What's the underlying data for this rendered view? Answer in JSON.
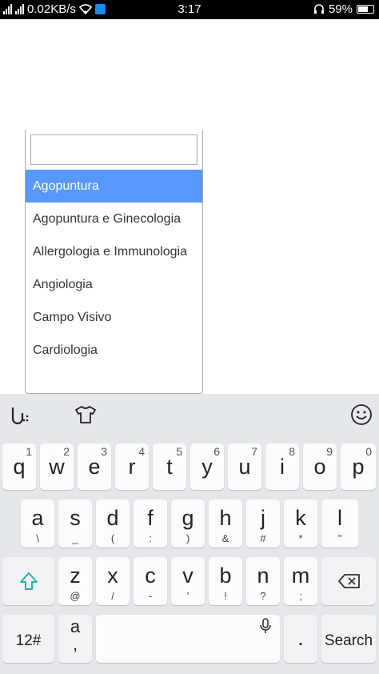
{
  "status_bar": {
    "speed": "0.02KB/s",
    "time": "3:17",
    "battery_percent": "59%",
    "icons": [
      "signal-icon",
      "signal-icon",
      "wifi-icon",
      "app-notification-icon",
      "headset-icon",
      "battery-icon"
    ]
  },
  "dropdown": {
    "search_value": "",
    "items": [
      {
        "label": "Agopuntura",
        "selected": true
      },
      {
        "label": "Agopuntura e Ginecologia",
        "selected": false
      },
      {
        "label": "Allergologia e Immunologia",
        "selected": false
      },
      {
        "label": "Angiologia",
        "selected": false
      },
      {
        "label": "Campo Visivo",
        "selected": false
      },
      {
        "label": "Cardiologia",
        "selected": false
      }
    ],
    "selected_color": "#5897fb"
  },
  "keyboard": {
    "toolbar": {
      "left_icon": "typing-hand-icon",
      "middle_icon": "shirt-theme-icon",
      "right_icon": "emoji-icon"
    },
    "row1": [
      {
        "char": "q",
        "hint": "1"
      },
      {
        "char": "w",
        "hint": "2"
      },
      {
        "char": "e",
        "hint": "3"
      },
      {
        "char": "r",
        "hint": "4"
      },
      {
        "char": "t",
        "hint": "5"
      },
      {
        "char": "y",
        "hint": "6"
      },
      {
        "char": "u",
        "hint": "7"
      },
      {
        "char": "i",
        "hint": "8"
      },
      {
        "char": "o",
        "hint": "9"
      },
      {
        "char": "p",
        "hint": "0"
      }
    ],
    "row2": [
      {
        "char": "a",
        "sub": "\\"
      },
      {
        "char": "s",
        "sub": "_"
      },
      {
        "char": "d",
        "sub": "("
      },
      {
        "char": "f",
        "sub": ":"
      },
      {
        "char": "g",
        "sub": ")"
      },
      {
        "char": "h",
        "sub": "&"
      },
      {
        "char": "j",
        "sub": "#"
      },
      {
        "char": "k",
        "sub": "*"
      },
      {
        "char": "l",
        "sub": "\""
      }
    ],
    "row3": [
      {
        "char": "z",
        "sub": "@"
      },
      {
        "char": "x",
        "sub": "/"
      },
      {
        "char": "c",
        "sub": "-"
      },
      {
        "char": "v",
        "sub": "'"
      },
      {
        "char": "b",
        "sub": "!"
      },
      {
        "char": "n",
        "sub": "?"
      },
      {
        "char": "m",
        "sub": ";"
      }
    ],
    "symbols_label": "12#",
    "lang_char": "a",
    "lang_sub": ",",
    "period": ".",
    "search_label": "Search",
    "accent_color": "#20b2aa"
  }
}
